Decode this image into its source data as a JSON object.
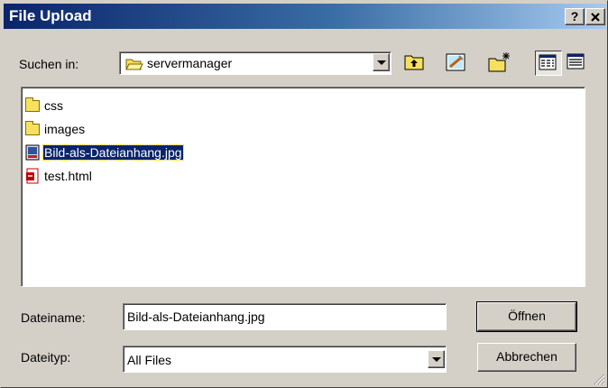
{
  "window": {
    "title": "File Upload",
    "help_btn": "?",
    "close_btn": "X"
  },
  "lookin": {
    "label": "Suchen in:",
    "value": "servermanager"
  },
  "toolbar": {
    "icons": [
      "up-folder-icon",
      "desktop-icon",
      "new-folder-icon",
      "list-view-icon",
      "details-view-icon"
    ]
  },
  "files": [
    {
      "name": "css",
      "icon": "folder-icon",
      "selected": false
    },
    {
      "name": "images",
      "icon": "folder-icon",
      "selected": false
    },
    {
      "name": "Bild-als-Dateianhang.jpg",
      "icon": "image-file-icon",
      "selected": true
    },
    {
      "name": "test.html",
      "icon": "html-file-icon",
      "selected": false
    }
  ],
  "filename": {
    "label": "Dateiname:",
    "value": "Bild-als-Dateianhang.jpg"
  },
  "filetype": {
    "label": "Dateityp:",
    "value": "All Files"
  },
  "buttons": {
    "open": "Öffnen",
    "cancel": "Abbrechen"
  },
  "colors": {
    "title_gradient_start": "#0a246a",
    "title_gradient_end": "#a6caf0",
    "selection": "#0a246a",
    "face": "#d4d0c8"
  }
}
